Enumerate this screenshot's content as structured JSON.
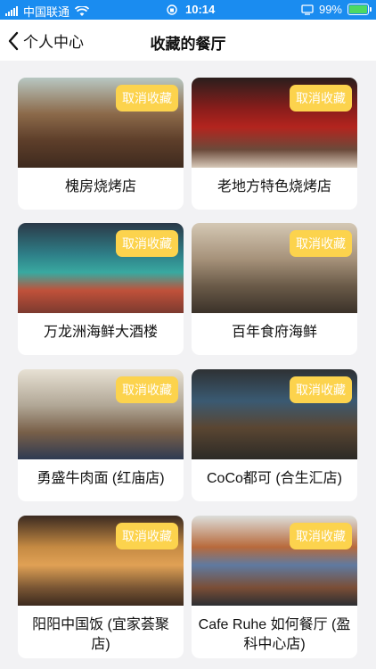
{
  "status_bar": {
    "carrier": "中国联通",
    "time": "10:14",
    "battery": "99%"
  },
  "nav": {
    "back_label": "个人中心",
    "title": "收藏的餐厅"
  },
  "unfavorite_label": "取消收藏",
  "restaurants": [
    {
      "name": "槐房烧烤店"
    },
    {
      "name": "老地方特色烧烤店"
    },
    {
      "name": "万龙洲海鲜大酒楼"
    },
    {
      "name": "百年食府海鲜"
    },
    {
      "name": "勇盛牛肉面 (红庙店)"
    },
    {
      "name": "CoCo都可 (合生汇店)"
    },
    {
      "name": "阳阳中国饭 (宜家荟聚店)"
    },
    {
      "name": "Cafe Ruhe 如何餐厅 (盈科中心店)"
    }
  ]
}
